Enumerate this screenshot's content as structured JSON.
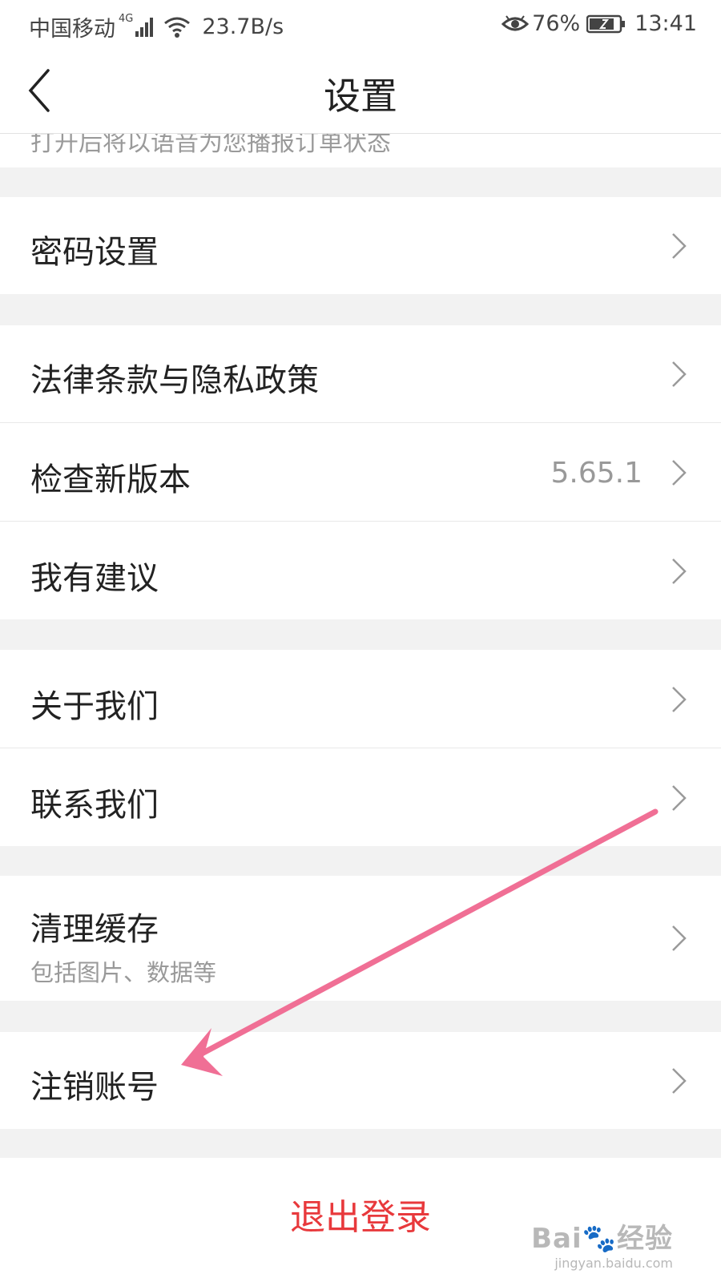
{
  "status_bar": {
    "carrier": "中国移动",
    "network": "4G",
    "speed": "23.7B/s",
    "battery": "76%",
    "time": "13:41"
  },
  "header": {
    "title": "设置"
  },
  "peek_text": "打开后将以语音为您播报订单状态",
  "rows": [
    {
      "label": "密码设置"
    },
    {
      "label": "法律条款与隐私政策"
    },
    {
      "label": "检查新版本",
      "value": "5.65.1"
    },
    {
      "label": "我有建议"
    },
    {
      "label": "关于我们"
    },
    {
      "label": "联系我们"
    },
    {
      "label": "清理缓存",
      "sub": "包括图片、数据等"
    },
    {
      "label": "注销账号"
    }
  ],
  "logout_label": "退出登录",
  "annotation": {
    "color": "#f06f95"
  },
  "accent_color": "#e8393c"
}
